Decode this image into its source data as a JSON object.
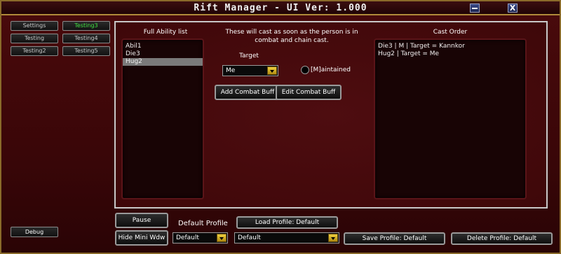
{
  "window": {
    "title": "Rift Manager - UI Ver: 1.000",
    "minimize_icon": "minimize-icon",
    "close_label": "X"
  },
  "sidebar": {
    "left_col": [
      {
        "label": "Settings",
        "active": false
      },
      {
        "label": "Testing",
        "active": false
      },
      {
        "label": "Testing2",
        "active": false
      }
    ],
    "right_col": [
      {
        "label": "Testing3",
        "active": true
      },
      {
        "label": "Testing4",
        "active": false
      },
      {
        "label": "Testing5",
        "active": false
      }
    ],
    "debug_label": "Debug"
  },
  "main": {
    "full_ability_title": "Full Ability list",
    "abilities": [
      "Abil1",
      "Die3",
      "Hug2"
    ],
    "selected_ability": "Hug2",
    "info_text_line1": "These will cast as soon as the person is in",
    "info_text_line2": "combat and chain cast.",
    "target_label": "Target",
    "target_value": "Me",
    "maintained_label": "[M]aintained",
    "add_button": "Add Combat Buff",
    "edit_button": "Edit Combat Buff",
    "cast_order_title": "Cast Order",
    "cast_order": [
      "Die3 | M | Target = Kannkor",
      "Hug2 | Target = Me"
    ]
  },
  "bottom": {
    "pause_label": "Pause",
    "hide_label": "Hide Mini Wdw",
    "default_profile_label": "Default Profile",
    "default_profile_value": "Default",
    "load_profile_label": "Load Profile: Default",
    "profile_select_value": "Default",
    "save_profile_label": "Save Profile: Default",
    "delete_profile_label": "Delete Profile: Default"
  },
  "colors": {
    "background": "#3a0608",
    "border_gold": "#b08a3a",
    "active_tab": "#40e040",
    "dropdown_arrow": "#f0d040"
  }
}
